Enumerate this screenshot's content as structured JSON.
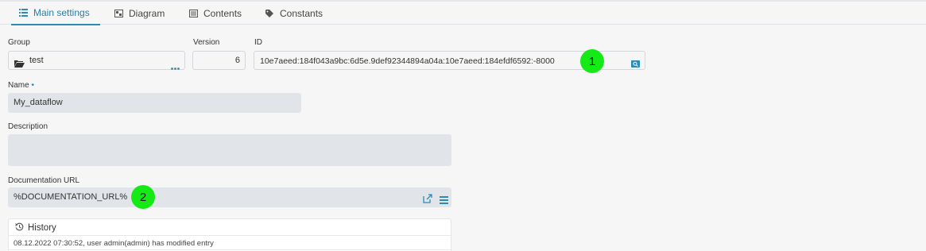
{
  "tabs": [
    {
      "label": "Main settings",
      "icon": "list-icon",
      "active": true
    },
    {
      "label": "Diagram",
      "icon": "diagram-icon",
      "active": false
    },
    {
      "label": "Contents",
      "icon": "contents-icon",
      "active": false
    },
    {
      "label": "Constants",
      "icon": "tag-icon",
      "active": false
    }
  ],
  "fields": {
    "group": {
      "label": "Group",
      "value": "test"
    },
    "version": {
      "label": "Version",
      "value": "6"
    },
    "id": {
      "label": "ID",
      "value": "10e7aeed:184f043a9bc:6d5e.9def92344894a04a:10e7aeed:184efdf6592:-8000"
    },
    "name": {
      "label": "Name",
      "required_mark": "•",
      "value": "My_dataflow"
    },
    "description": {
      "label": "Description",
      "value": ""
    },
    "doc_url": {
      "label": "Documentation URL",
      "value": "%DOCUMENTATION_URL%"
    }
  },
  "markers": {
    "one": "1",
    "two": "2"
  },
  "history": {
    "title": "History",
    "entries": [
      "08.12.2022 07:30:52, user admin(admin) has modified entry"
    ]
  },
  "colors": {
    "accent": "#2a8ab8",
    "marker": "#16ea16",
    "field_bg": "#e1e4e8"
  }
}
